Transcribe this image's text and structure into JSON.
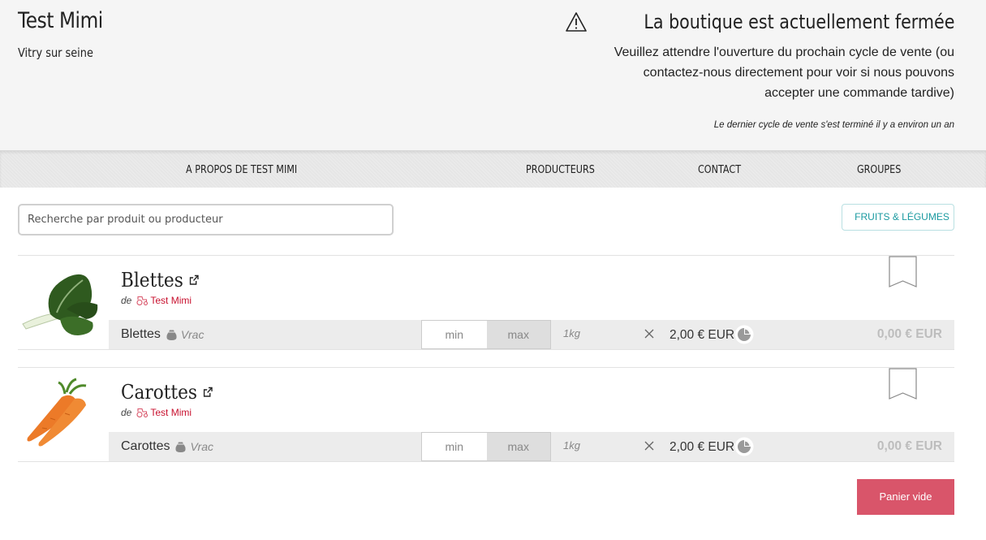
{
  "header": {
    "shop_name": "Test Mimi",
    "city": "Vitry sur seine",
    "closed_title": "La boutique est actuellement fermée",
    "closed_message": "Veuillez attendre l'ouverture du prochain cycle de vente (ou contactez-nous directement pour voir si nous pouvons accepter une commande tardive)",
    "closed_note": "Le dernier cycle de vente s'est terminé il y a environ un an"
  },
  "nav": {
    "items": [
      {
        "label": "A propos de Test Mimi"
      },
      {
        "label": "Producteurs"
      },
      {
        "label": "Contact"
      },
      {
        "label": "Groupes"
      }
    ]
  },
  "search": {
    "placeholder": "Recherche par produit ou producteur"
  },
  "filters": {
    "category": "FRUITS & LÉGUMES"
  },
  "products": [
    {
      "name": "Blettes",
      "by": "de",
      "producer": "Test Mimi",
      "variant": "Blettes",
      "variant_tag": "Vrac",
      "min_label": "min",
      "max_label": "max",
      "unit": "1kg",
      "price": "2,00 € EUR",
      "total": "0,00 € EUR"
    },
    {
      "name": "Carottes",
      "by": "de",
      "producer": "Test Mimi",
      "variant": "Carottes",
      "variant_tag": "Vrac",
      "min_label": "min",
      "max_label": "max",
      "unit": "1kg",
      "price": "2,00 € EUR",
      "total": "0,00 € EUR"
    }
  ],
  "cart": {
    "label": "Panier vide"
  },
  "colors": {
    "producer_link": "#c8102e",
    "cart_button": "#d9556a",
    "category_accent": "#1a9aa0"
  }
}
